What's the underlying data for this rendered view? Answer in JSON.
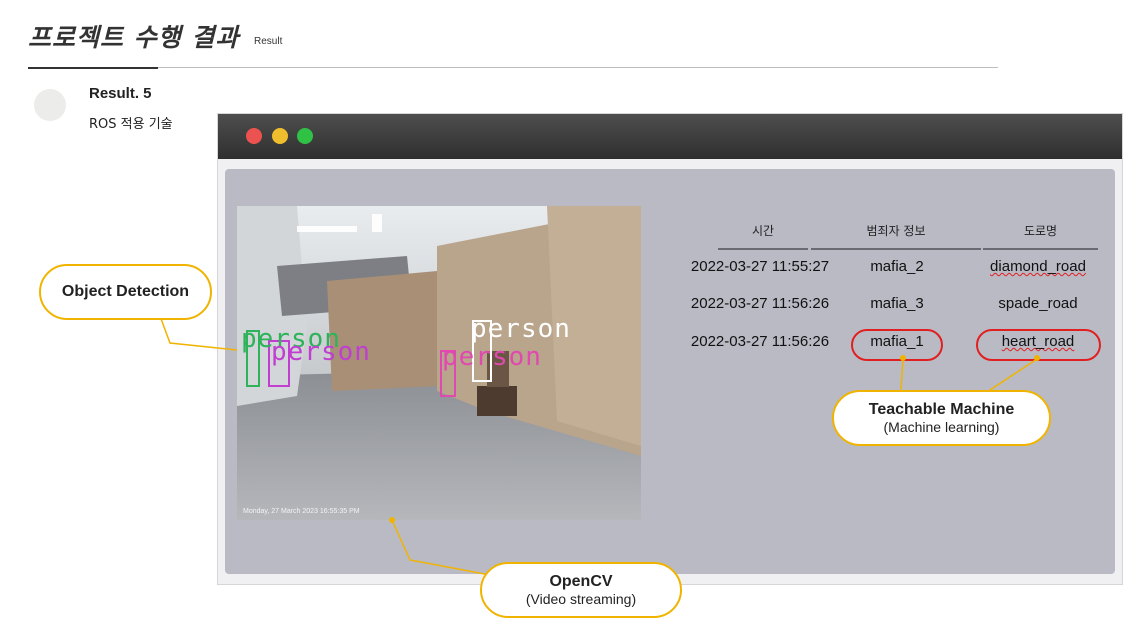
{
  "header": {
    "title": "프로젝트 수행 결과",
    "subtitle": "Result"
  },
  "result": {
    "number_label": "Result. 5",
    "description": "ROS 적용 기술"
  },
  "window": {
    "traffic_lights": [
      "#ec5350",
      "#f0bd2c",
      "#30c245"
    ]
  },
  "video": {
    "detections": [
      "person",
      "person",
      "person",
      "person"
    ],
    "timestamp": "Monday, 27 March 2023 16:55:35 PM"
  },
  "table": {
    "headers": [
      "시간",
      "범죄자 정보",
      "도로명"
    ],
    "rows": [
      {
        "time": "2022-03-27 11:55:27",
        "criminal": "mafia_2",
        "road": "diamond_road"
      },
      {
        "time": "2022-03-27 11:56:26",
        "criminal": "mafia_3",
        "road": "spade_road"
      },
      {
        "time": "2022-03-27 11:56:26",
        "criminal": "mafia_1",
        "road": "heart_road"
      }
    ]
  },
  "callouts": {
    "object_detection": {
      "title": "Object Detection"
    },
    "teachable": {
      "title": "Teachable Machine",
      "subtitle": "(Machine learning)"
    },
    "opencv": {
      "title": "OpenCV",
      "subtitle": "(Video streaming)"
    }
  },
  "colors": {
    "accent_outline": "#f0b400",
    "highlight": "#e02020",
    "panel_bg": "#babac5"
  }
}
